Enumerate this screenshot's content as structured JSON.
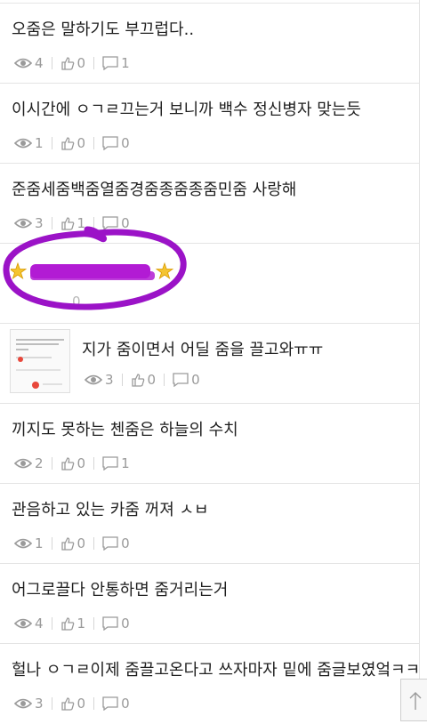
{
  "posts": [
    {
      "title": "오줌은 말하기도 부끄럽다..",
      "views": "4",
      "likes": "0",
      "comments": "1"
    },
    {
      "title": "이시간에 ㅇㄱㄹ끄는거 보니까 백수 정신병자 맞는듯",
      "views": "1",
      "likes": "0",
      "comments": "0"
    },
    {
      "title": "준줌세줌백줌열줌경줌종줌종줌민줌 사랑해",
      "views": "3",
      "likes": "1",
      "comments": "0"
    },
    {
      "title": "",
      "views": "",
      "likes": "0",
      "comments": ""
    },
    {
      "title": "지가 줌이면서 어딜 줌을 끌고와ㅠㅠ",
      "views": "3",
      "likes": "0",
      "comments": "0"
    },
    {
      "title": "끼지도 못하는 첸줌은 하늘의 수치",
      "views": "2",
      "likes": "0",
      "comments": "1"
    },
    {
      "title": "관음하고 있는 카줌 꺼져 ㅅㅂ",
      "views": "1",
      "likes": "0",
      "comments": "0"
    },
    {
      "title": "어그로끌다 안통하면 줌거리는거",
      "views": "4",
      "likes": "1",
      "comments": "0"
    },
    {
      "title": "헐나 ㅇㄱㄹ이제 줌끌고온다고 쓰자마자 밑에 줌글보였엌ㅋㅋ",
      "views": "3",
      "likes": "0",
      "comments": "0"
    }
  ],
  "colors": {
    "highlight": "#9b13c7",
    "redaction": "#b21bd4",
    "star": "#f4c430",
    "meta": "#9a9a9a"
  },
  "icons": {
    "views": "eye-icon",
    "likes": "thumbs-up-icon",
    "comments": "speech-bubble-icon",
    "star": "star-icon",
    "scroll_top": "arrow-up-icon"
  }
}
